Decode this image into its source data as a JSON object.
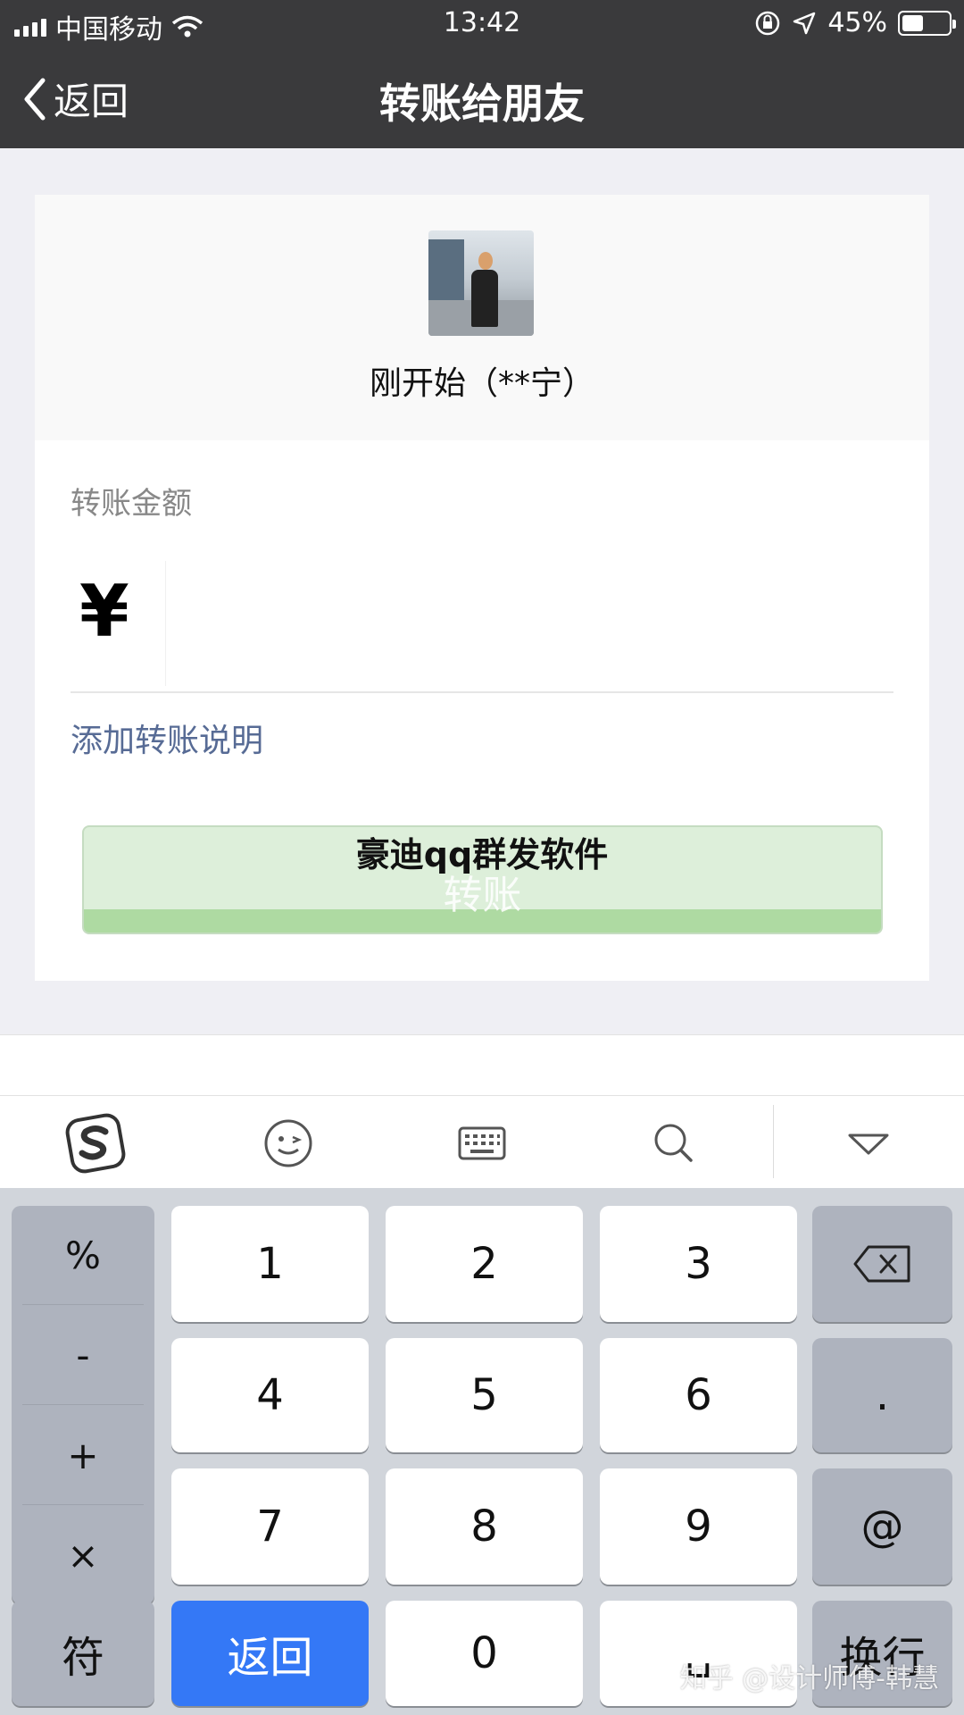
{
  "status_bar": {
    "carrier": "中国移动",
    "time": "13:42",
    "battery": "45%",
    "battery_level": 0.45
  },
  "nav": {
    "back_label": "返回",
    "title": "转账给朋友"
  },
  "recipient": {
    "name": "刚开始（**宁）"
  },
  "transfer": {
    "amount_label": "转账金额",
    "currency_symbol": "¥",
    "amount_value": "",
    "add_note_label": "添加转账说明",
    "button_label": "转账"
  },
  "overlay_text": "豪迪qq群发软件",
  "keyboard_toolbar": {
    "icons": [
      "sogou-logo-icon",
      "emoji-icon",
      "keyboard-icon",
      "search-icon",
      "collapse-keyboard-icon"
    ]
  },
  "keyboard": {
    "symbols": [
      "%",
      "-",
      "+",
      "×"
    ],
    "digits": [
      "1",
      "2",
      "3",
      "4",
      "5",
      "6",
      "7",
      "8",
      "9",
      "0"
    ],
    "dot": ".",
    "at": "@",
    "symbol_key": "符",
    "return_key": "返回",
    "enter_key": "换行",
    "space_key": "␣"
  },
  "watermark": "知乎 @设计师傅-韩慧"
}
